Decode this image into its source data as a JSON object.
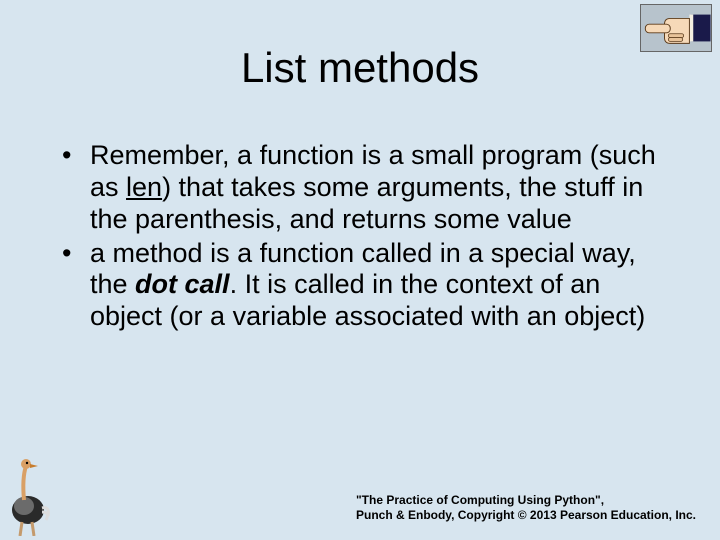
{
  "title": "List methods",
  "bullets": [
    {
      "pre": "Remember, a function is a small program (such as ",
      "u": "len",
      "post": ") that takes some arguments, the stuff in the parenthesis, and returns some value"
    },
    {
      "pre": "a method is a function called in a special way, the ",
      "bi": "dot call",
      "post": ". It is called in the context of an object (or a variable associated with an object)"
    }
  ],
  "footer": {
    "line1": "\"The Practice of Computing Using Python\",",
    "line2": "Punch & Enbody, Copyright © 2013 Pearson Education, Inc."
  },
  "icons": {
    "hand": "pointing-hand-icon",
    "ostrich": "ostrich-icon"
  }
}
